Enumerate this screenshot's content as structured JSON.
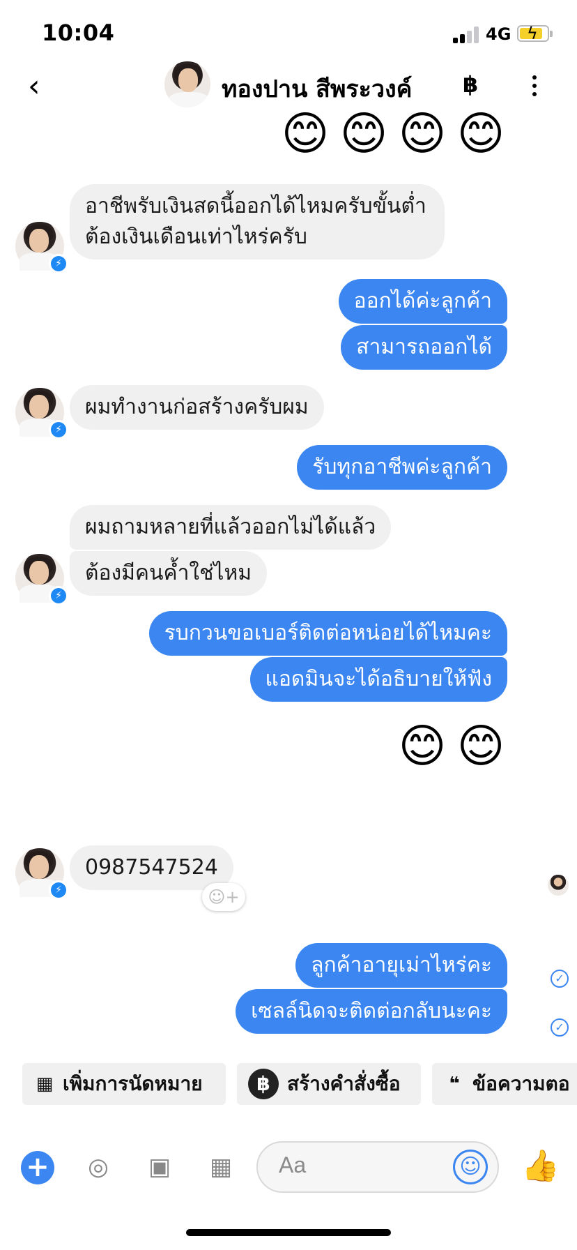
{
  "status_bar": {
    "time": "10:04",
    "network": "4G"
  },
  "header": {
    "contact_name": "ทองปาน สีพระวงค์",
    "baht_icon": "฿",
    "back_icon": "chevron-left-icon",
    "more_icon": "more-vertical-icon"
  },
  "emoji": "😊",
  "messages": {
    "in1": "อาชีพรับเงินสดนี้ออกได้ไหมครับขั้นต่ำต้องเงินเดือนเท่าไหร่ครับ",
    "out1": "ออกได้ค่ะลูกค้า",
    "out2": "สามารถออกได้",
    "in2": "ผมทำงานก่อสร้างครับผม",
    "out3": "รับทุกอาชีพค่ะลูกค้า",
    "in3": "ผมถามหลายที่แล้วออกไม่ได้แล้ว",
    "in4": "ต้องมีคนค้ำใช่ไหม",
    "out4": "รบกวนขอเบอร์ติดต่อหน่อยได้ไหมคะ",
    "out5": "แอดมินจะได้อธิบายให้ฟัง",
    "in5": "0987547524",
    "out6": "ลูกค้าอายุเม่าไหร่คะ",
    "out7": "เซลล์นิดจะติดต่อกลับนะคะ"
  },
  "quick_actions": [
    {
      "label": "เพิ่มการนัดหมาย",
      "icon": "calendar-icon"
    },
    {
      "label": "สร้างคำสั่งซื้อ",
      "icon": "baht-icon"
    },
    {
      "label": "ข้อความตอ",
      "icon": "chat-bubbles-icon"
    }
  ],
  "composer": {
    "placeholder": "Aa"
  },
  "colors": {
    "outgoing": "#3b86f0",
    "incoming": "#f0f0f0",
    "messenger_badge": "#1e88f5"
  }
}
